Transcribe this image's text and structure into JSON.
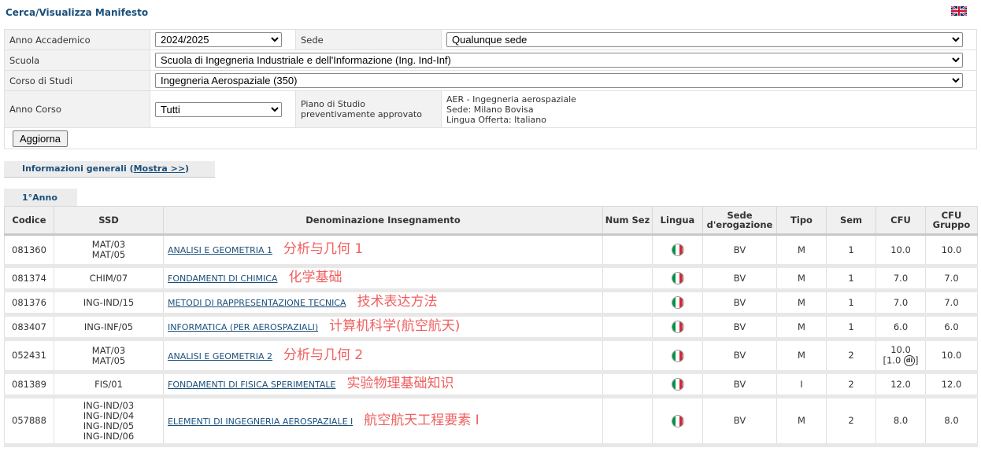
{
  "header": {
    "title": "Cerca/Visualizza Manifesto",
    "lang_flag": "uk-flag-icon"
  },
  "form": {
    "anno_accademico_label": "Anno Accademico",
    "anno_accademico_value": "2024/2025",
    "sede_label": "Sede",
    "sede_value": "Qualunque sede",
    "scuola_label": "Scuola",
    "scuola_value": "Scuola di Ingegneria Industriale e dell'Informazione (Ing. Ind-Inf)",
    "corso_label": "Corso di Studi",
    "corso_value": "Ingegneria Aerospaziale (350)",
    "anno_corso_label": "Anno Corso",
    "anno_corso_value": "Tutti",
    "piano_label": "Piano di Studio preventivamente approvato",
    "piano_lines": [
      "AER - Ingegneria aerospaziale",
      "Sede: Milano Bovisa",
      "Lingua Offerta: Italiano"
    ],
    "update_button": "Aggiorna"
  },
  "info_tab": {
    "label": "Informazioni generali (",
    "link": "Mostra >>",
    "close": ")"
  },
  "year_tab": "1°Anno",
  "table": {
    "headers": [
      "Codice",
      "SSD",
      "Denominazione Insegnamento",
      "Num Sez",
      "Lingua",
      "Sede d'erogazione",
      "Tipo",
      "Sem",
      "CFU",
      "CFU Gruppo"
    ],
    "rows": [
      {
        "codice": "081360",
        "ssd": [
          "MAT/03",
          "MAT/05"
        ],
        "nome": "ANALISI E GEOMETRIA 1",
        "note": "分析与几何 1",
        "sede": "BV",
        "tipo": "M",
        "sem": "1",
        "cfu": "10.0",
        "cfu_extra": "",
        "cfu_gruppo": "10.0"
      },
      {
        "codice": "081374",
        "ssd": [
          "CHIM/07"
        ],
        "nome": "FONDAMENTI DI CHIMICA",
        "note": "化学基础",
        "sede": "BV",
        "tipo": "M",
        "sem": "1",
        "cfu": "7.0",
        "cfu_extra": "",
        "cfu_gruppo": "7.0"
      },
      {
        "codice": "081376",
        "ssd": [
          "ING-IND/15"
        ],
        "nome": "METODI DI RAPPRESENTAZIONE TECNICA",
        "note": "技术表达方法",
        "sede": "BV",
        "tipo": "M",
        "sem": "1",
        "cfu": "7.0",
        "cfu_extra": "",
        "cfu_gruppo": "7.0"
      },
      {
        "codice": "083407",
        "ssd": [
          "ING-INF/05"
        ],
        "nome": "INFORMATICA (PER AEROSPAZIALI)",
        "note": "计算机科学(航空航天)",
        "sede": "BV",
        "tipo": "M",
        "sem": "1",
        "cfu": "6.0",
        "cfu_extra": "",
        "cfu_gruppo": "6.0"
      },
      {
        "codice": "052431",
        "ssd": [
          "MAT/03",
          "MAT/05"
        ],
        "nome": "ANALISI E GEOMETRIA 2",
        "note": "分析与几何 2",
        "sede": "BV",
        "tipo": "M",
        "sem": "2",
        "cfu": "10.0",
        "cfu_extra": "[1.0 ",
        "cfu_gruppo": "10.0"
      },
      {
        "codice": "081389",
        "ssd": [
          "FIS/01"
        ],
        "nome": "FONDAMENTI DI FISICA SPERIMENTALE",
        "note": "实验物理基础知识",
        "sede": "BV",
        "tipo": "I",
        "sem": "2",
        "cfu": "12.0",
        "cfu_extra": "",
        "cfu_gruppo": "12.0"
      },
      {
        "codice": "057888",
        "ssd": [
          "ING-IND/03",
          "ING-IND/04",
          "ING-IND/05",
          "ING-IND/06"
        ],
        "nome": "ELEMENTI DI INGEGNERIA AEROSPAZIALE I",
        "note": "航空航天工程要素 I",
        "sede": "BV",
        "tipo": "M",
        "sem": "2",
        "cfu": "8.0",
        "cfu_extra": "",
        "cfu_gruppo": "8.0"
      }
    ]
  },
  "colors": {
    "link": "#1a4f7a",
    "annotation": "#f06060",
    "header_bg": "#f0f0f0"
  }
}
